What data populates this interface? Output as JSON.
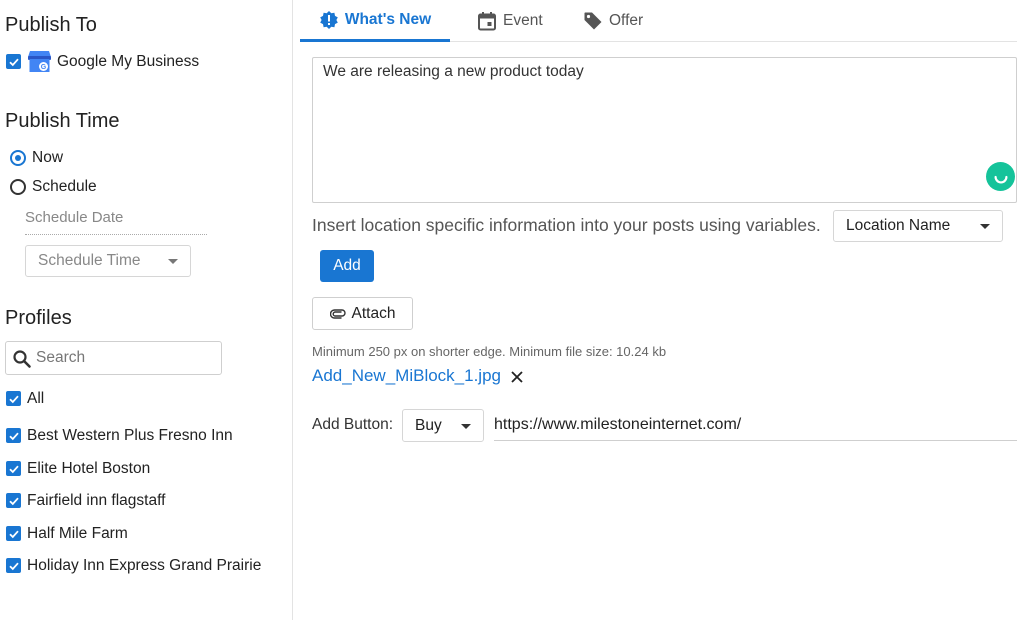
{
  "sidebar": {
    "publish_to": {
      "title": "Publish To",
      "channel": {
        "label": "Google My Business",
        "checked": true,
        "icon": "google-my-business-icon"
      }
    },
    "publish_time": {
      "title": "Publish Time",
      "options": [
        {
          "label": "Now",
          "selected": true
        },
        {
          "label": "Schedule",
          "selected": false
        }
      ],
      "schedule_date_placeholder": "Schedule Date",
      "schedule_time_placeholder": "Schedule Time"
    },
    "profiles": {
      "title": "Profiles",
      "search_placeholder": "Search",
      "items": [
        {
          "label": "All",
          "checked": true
        },
        {
          "label": "Best Western Plus Fresno Inn",
          "checked": true
        },
        {
          "label": "Elite Hotel Boston",
          "checked": true
        },
        {
          "label": "Fairfield inn flagstaff",
          "checked": true
        },
        {
          "label": "Half Mile Farm",
          "checked": true
        },
        {
          "label": "Holiday Inn Express Grand Prairie",
          "checked": true
        }
      ]
    }
  },
  "main": {
    "tabs": [
      {
        "label": "What's New",
        "icon": "alert-badge-icon",
        "active": true
      },
      {
        "label": "Event",
        "icon": "calendar-icon",
        "active": false
      },
      {
        "label": "Offer",
        "icon": "tag-icon",
        "active": false
      }
    ],
    "post_text": "We are releasing a new product today",
    "variables_text": "Insert location specific information into your posts using variables.",
    "variable_select": "Location Name",
    "add_label": "Add",
    "attach_label": "Attach",
    "attach_hint": "Minimum 250 px on shorter edge. Minimum file size: 10.24 kb",
    "attached_file": "Add_New_MiBlock_1.jpg",
    "cta_label": "Add Button:",
    "cta_select": "Buy",
    "cta_url": "https://www.milestoneinternet.com/"
  },
  "colors": {
    "accent": "#1976d2",
    "grammarly": "#15c39a"
  }
}
